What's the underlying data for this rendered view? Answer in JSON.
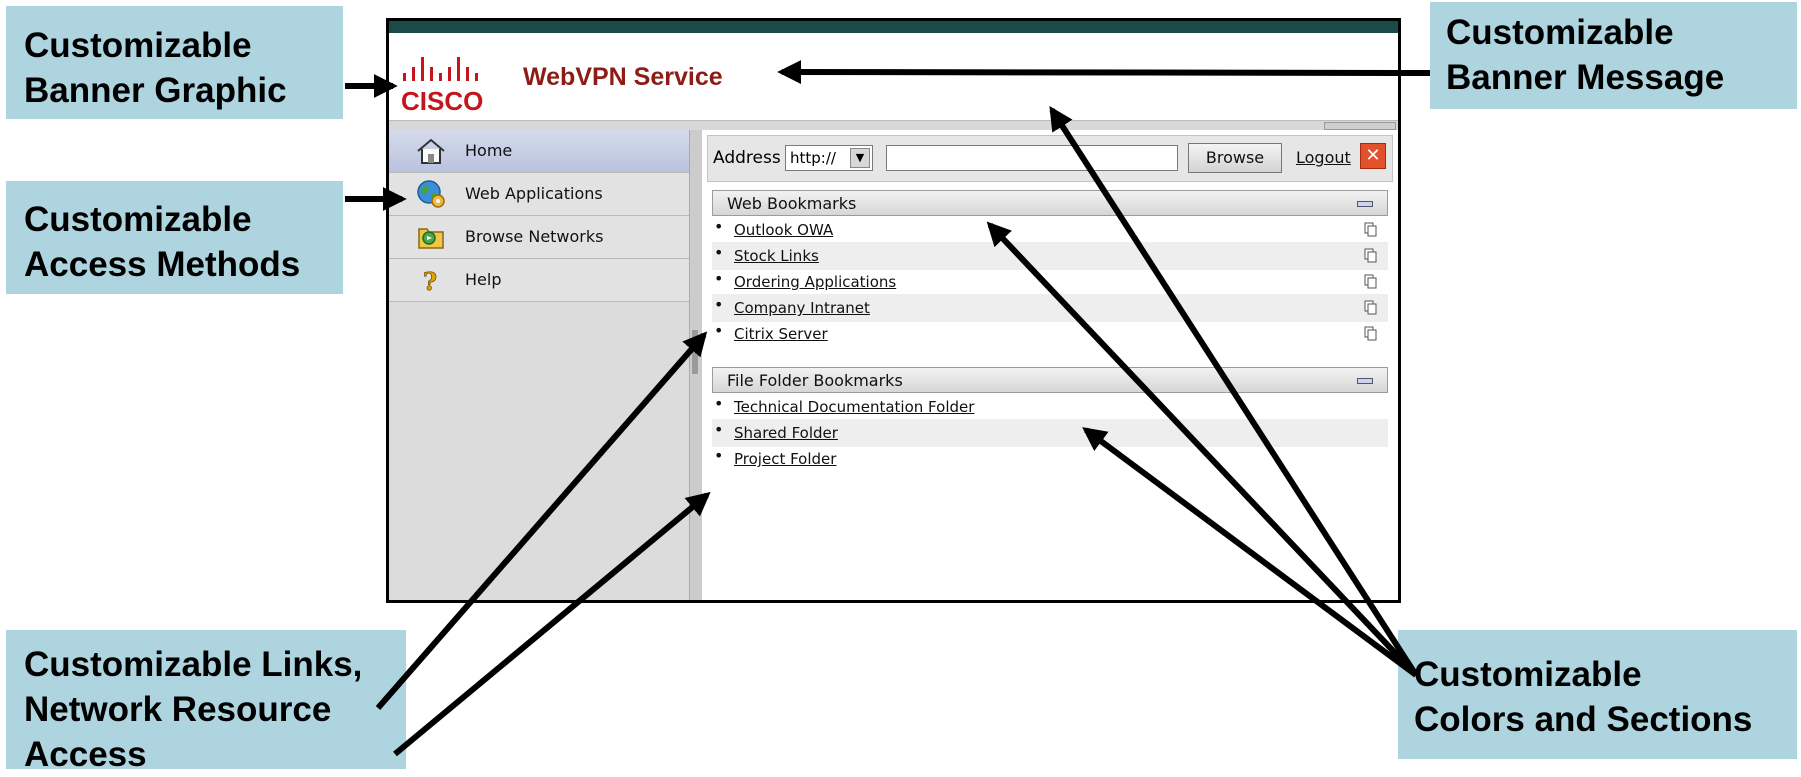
{
  "callouts": {
    "banner_graphic": [
      "Customizable",
      "Banner Graphic"
    ],
    "banner_message": [
      "Customizable",
      "Banner Message"
    ],
    "access_methods": [
      "Customizable",
      "Access Methods"
    ],
    "links": [
      "Customizable Links,",
      "Network Resource",
      "Access"
    ],
    "colors_sections": [
      "Customizable",
      "Colors and Sections"
    ]
  },
  "colors": {
    "callout_bg": "#add4df",
    "banner_title": "#8d1c16",
    "cisco_red": "#c4161c",
    "header_bar": "#1c4a46"
  },
  "banner": {
    "logo_text": "CISCO",
    "title": "WebVPN Service"
  },
  "sidebar": {
    "items": [
      {
        "label": "Home",
        "icon": "home-icon",
        "active": true
      },
      {
        "label": "Web Applications",
        "icon": "globe-gear-icon",
        "active": false
      },
      {
        "label": "Browse Networks",
        "icon": "network-folder-icon",
        "active": false
      },
      {
        "label": "Help",
        "icon": "question-icon",
        "active": false
      }
    ]
  },
  "address_bar": {
    "label": "Address",
    "protocol": "http://",
    "url": "",
    "browse_label": "Browse",
    "logout_label": "Logout"
  },
  "web_bookmarks": {
    "title": "Web Bookmarks",
    "items": [
      "Outlook OWA",
      "Stock Links",
      "Ordering Applications",
      "Company Intranet",
      "Citrix Server"
    ]
  },
  "file_bookmarks": {
    "title": "File Folder Bookmarks",
    "items": [
      "Technical Documentation Folder",
      "Shared Folder",
      "Project Folder"
    ]
  }
}
